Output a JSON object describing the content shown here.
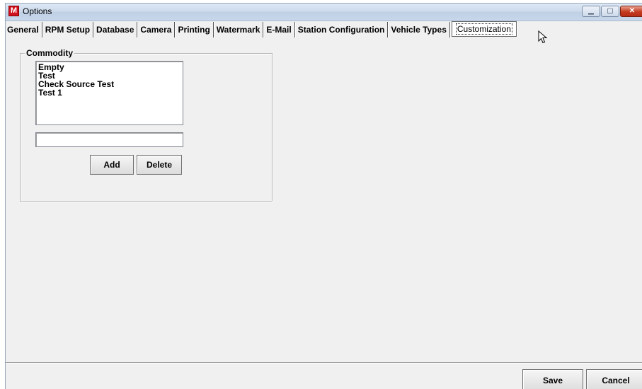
{
  "window": {
    "title": "Options",
    "icon": "app-logo-icon",
    "icon_letter": "M",
    "controls": {
      "minimize": "minimize-icon",
      "maximize": "maximize-icon",
      "close": "close-icon"
    }
  },
  "tabs": [
    {
      "label": "General"
    },
    {
      "label": "RPM Setup"
    },
    {
      "label": "Database"
    },
    {
      "label": "Camera"
    },
    {
      "label": "Printing"
    },
    {
      "label": "Watermark"
    },
    {
      "label": "E-Mail"
    },
    {
      "label": "Station Configuration"
    },
    {
      "label": "Vehicle Types"
    },
    {
      "label": "Customization",
      "active": true
    }
  ],
  "commodity": {
    "group_title": "Commodity",
    "items": [
      "Empty",
      "Test",
      "Check Source Test",
      "Test 1"
    ],
    "input_value": "",
    "add_label": "Add",
    "delete_label": "Delete"
  },
  "footer": {
    "save_label": "Save",
    "cancel_label": "Cancel"
  }
}
